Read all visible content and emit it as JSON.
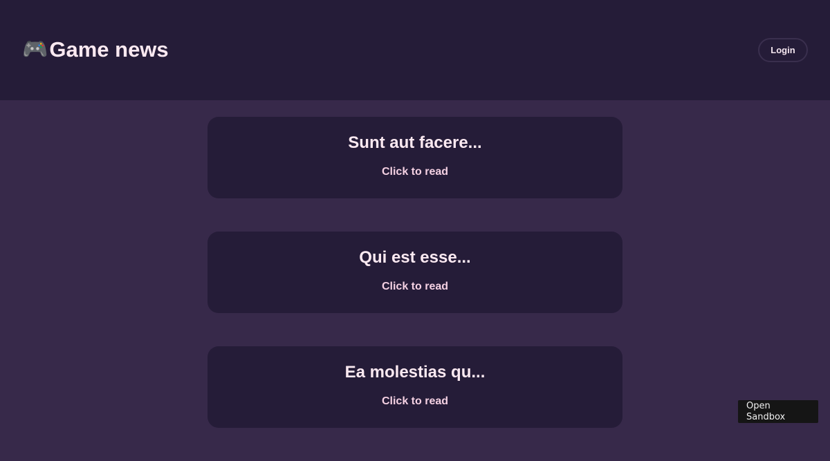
{
  "header": {
    "brand_icon": "🎮",
    "brand_icon_name": "gamepad-icon",
    "title": "Game news",
    "login_label": "Login"
  },
  "posts": [
    {
      "title": "Sunt aut facere...",
      "link_label": "Click to read"
    },
    {
      "title": "Qui est esse...",
      "link_label": "Click to read"
    },
    {
      "title": "Ea molestias qu...",
      "link_label": "Click to read"
    }
  ],
  "sandbox": {
    "label": "Open Sandbox"
  },
  "colors": {
    "page_background": "#37294a",
    "header_background": "#251c38",
    "card_background": "#251c38",
    "text_primary": "#fbe9f1",
    "text_link": "#f5d1e3",
    "sandbox_background": "#151515"
  }
}
